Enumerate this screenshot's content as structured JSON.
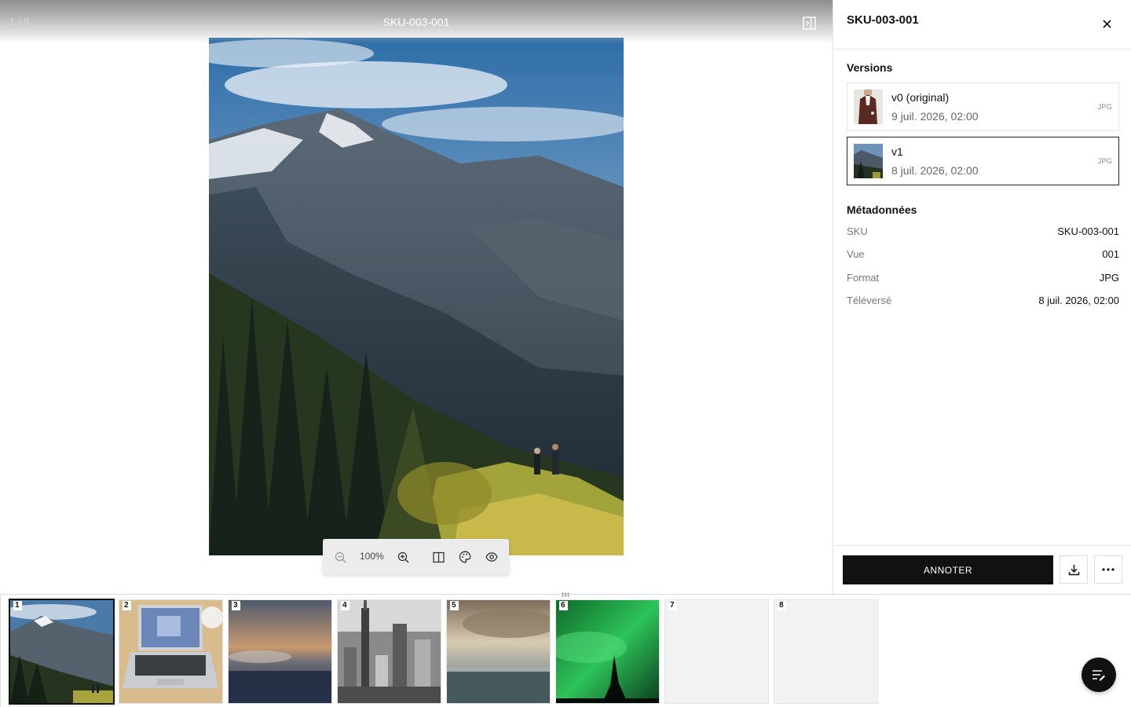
{
  "viewer": {
    "counter": "1 / 8",
    "title": "SKU-003-001",
    "zoom": "100%"
  },
  "panel": {
    "title": "SKU-003-001",
    "versions_heading": "Versions",
    "versions": [
      {
        "label": "v0 (original)",
        "date": "9 juil. 2026, 02:00",
        "format": "JPG",
        "selected": false
      },
      {
        "label": "v1",
        "date": "8 juil. 2026, 02:00",
        "format": "JPG",
        "selected": true
      }
    ],
    "metadata_heading": "Métadonnées",
    "metadata": [
      {
        "key": "SKU",
        "value": "SKU-003-001"
      },
      {
        "key": "Vue",
        "value": "001"
      },
      {
        "key": "Format",
        "value": "JPG"
      },
      {
        "key": "Téléversé",
        "value": "8 juil. 2026, 02:00"
      }
    ],
    "annotate_label": "ANNOTER"
  },
  "filmstrip": {
    "items": [
      {
        "num": "1",
        "content": "mountain hikers",
        "active": true
      },
      {
        "num": "2",
        "content": "laptop on desk",
        "active": false
      },
      {
        "num": "3",
        "content": "ocean sunset wave",
        "active": false
      },
      {
        "num": "4",
        "content": "city skyline bw",
        "active": false
      },
      {
        "num": "5",
        "content": "sea under clouds",
        "active": false
      },
      {
        "num": "6",
        "content": "aurora tree",
        "active": false
      },
      {
        "num": "7",
        "content": "empty",
        "active": false
      },
      {
        "num": "8",
        "content": "empty",
        "active": false
      }
    ]
  },
  "icons": {
    "panel_toggle": "panel-toggle-icon",
    "close": "close-icon",
    "zoom_out": "zoom-out-icon",
    "zoom_in": "zoom-in-icon",
    "compare": "split-view-icon",
    "palette": "palette-icon",
    "visibility": "eye-icon",
    "download": "download-icon",
    "more": "more-icon",
    "fab": "list-edit-icon",
    "drag": "drag-handle-icon"
  },
  "colors": {
    "primary_button": "#111111",
    "selected_border": "#222222"
  }
}
